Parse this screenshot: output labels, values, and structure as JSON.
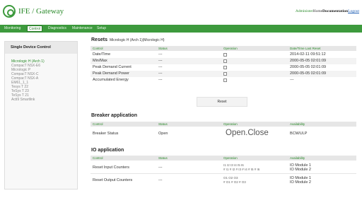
{
  "header": {
    "title": "IFE / Gateway",
    "links": {
      "admin": "Administer",
      "home": "Home",
      "documentation": "Documentation",
      "logout": "Logout"
    }
  },
  "nav": {
    "tabs": [
      "Monitoring",
      "Control",
      "Diagnostics",
      "Maintenance",
      "Setup"
    ],
    "active": "Control"
  },
  "sidebar": {
    "heading": "Single Device Control",
    "devices": [
      "Micrologic H (Arch 1)",
      "CompacT NSX-E6",
      "Micrologic P",
      "CompacT NSX-C",
      "CompacT NSX-A",
      "EM61_1_1",
      "Tesys T 22",
      "TeSys T 23",
      "TeSys T 21",
      "Acti9 Smartlink"
    ],
    "active_index": 0
  },
  "resets": {
    "title": "Resets",
    "subtitle": "Micrologic H (Arch 1)(Micrologic H)",
    "columns": [
      "Control",
      "Status",
      "Operation",
      "Date/Time Last Reset"
    ],
    "rows": [
      {
        "control": "Date/Time",
        "status": "---",
        "datetime": "2014-02-11 09:51:12"
      },
      {
        "control": "Min/Max",
        "status": "---",
        "datetime": "2000-05-05 02:01:09"
      },
      {
        "control": "Peak Demand Current",
        "status": "---",
        "datetime": "2000-05-05 02:01:09"
      },
      {
        "control": "Peak Demand Power",
        "status": "---",
        "datetime": "2000-05-05 02:01:09"
      },
      {
        "control": "Accumulated Energy",
        "status": "---",
        "datetime": "---"
      }
    ],
    "reset_button": "Reset"
  },
  "breaker": {
    "title": "Breaker application",
    "columns": [
      "Control",
      "Status",
      "Operation",
      "Availability"
    ],
    "row": {
      "control": "Breaker Status",
      "status": "Open",
      "operation": "Open.Close",
      "availability": "BCM/ULP"
    }
  },
  "io": {
    "title": "IO application",
    "columns": [
      "Control",
      "Status",
      "Operation",
      "Availability"
    ],
    "rows": [
      {
        "control": "Reset Input Counters",
        "status": "---",
        "op_line1": "I1    I2    I3    I4    I5    I6",
        "op_line2": "# I1  # I2  # I3  # I4  # I5  # I6",
        "avail_line1": "IO Module 1",
        "avail_line2": "IO Module 2"
      },
      {
        "control": "Reset Output Counters",
        "status": "---",
        "op_line1": "O1    O2    O3",
        "op_line2": "# O1  # O2  # O3",
        "avail_line1": "IO Module 1",
        "avail_line2": "IO Module 2"
      }
    ]
  }
}
